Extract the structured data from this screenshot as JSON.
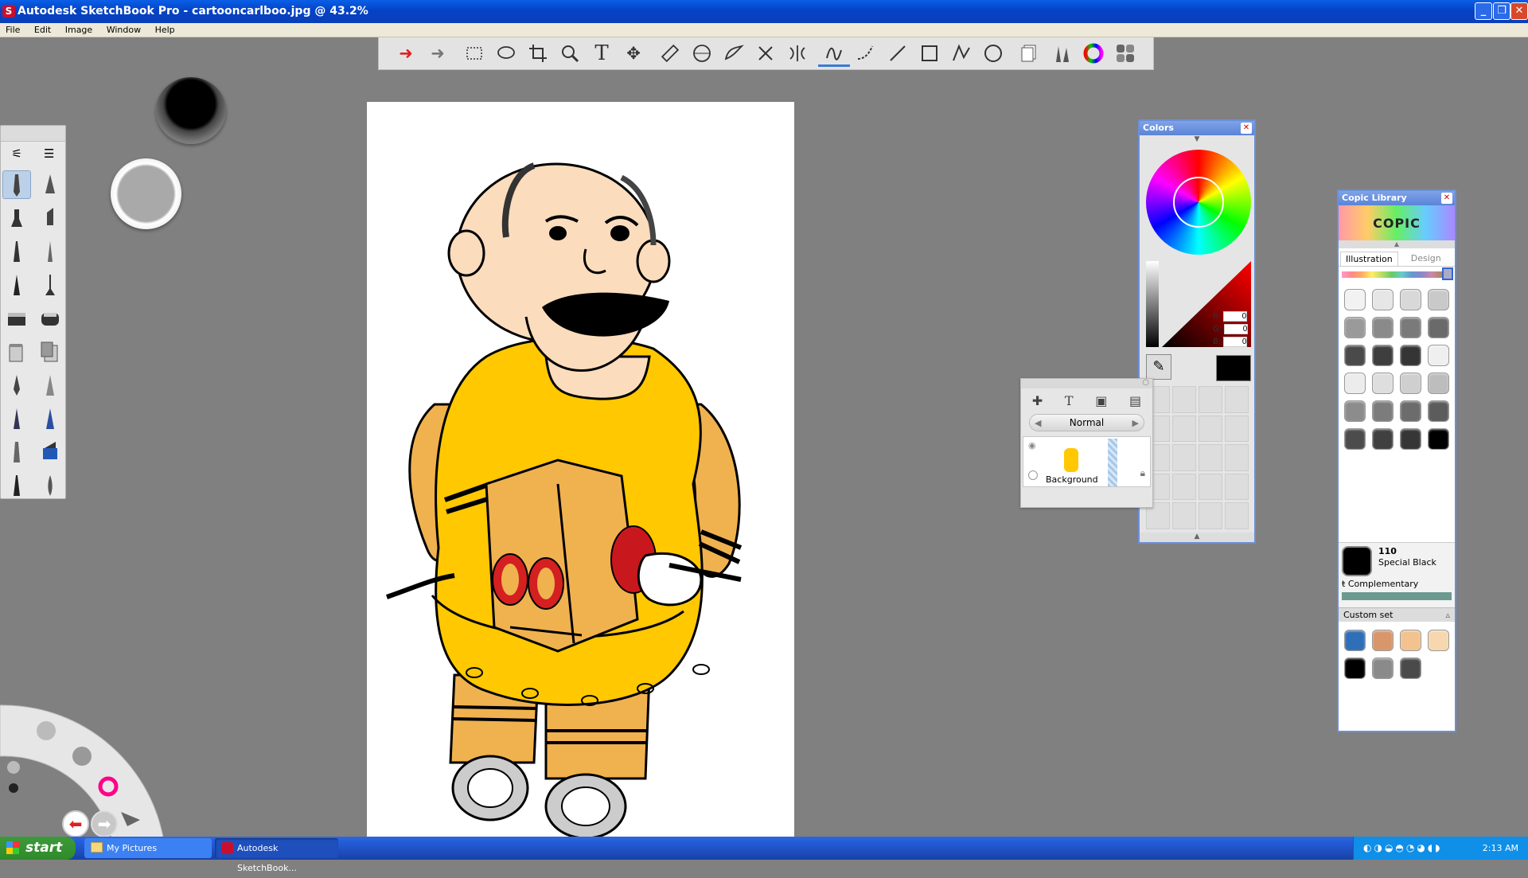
{
  "window": {
    "title": "Autodesk SketchBook Pro - cartooncarlboo.jpg @ 43.2%"
  },
  "menu": [
    "File",
    "Edit",
    "Image",
    "Window",
    "Help"
  ],
  "colors_panel": {
    "title": "Colors",
    "r_label": "R:",
    "g_label": "G:",
    "b_label": "B:",
    "r": "0",
    "g": "0",
    "b": "0",
    "current_color": "#000000"
  },
  "layers_panel": {
    "blend_mode": "Normal",
    "layer_name": "Background"
  },
  "copic": {
    "title": "Copic Library",
    "logo": "COPIC",
    "tabs": [
      "Illustration",
      "Design"
    ],
    "active_color_code": "110",
    "active_color_name": "Special Black",
    "complementary_label": "Complementary",
    "custom_set_label": "Custom set",
    "library_swatches": [
      "#f2f2f2",
      "#e6e6e6",
      "#d8d8d8",
      "#c9c9c9",
      "#9a9a9a",
      "#8a8a8a",
      "#7a7a7a",
      "#6a6a6a",
      "#4a4a4a",
      "#3e3e3e",
      "#353535",
      "#efefef",
      "#ececec",
      "#dedede",
      "#cfcfcf",
      "#bdbdbd",
      "#8c8c8c",
      "#7c7c7c",
      "#6c6c6c",
      "#5c5c5c",
      "#4c4c4c",
      "#404040",
      "#363636",
      "#000000"
    ],
    "custom_swatches": [
      "#2f6fb8",
      "#d9966a",
      "#f2c28f",
      "#f7d7ad",
      "#000000",
      "#8a8a8a",
      "#4a4a4a"
    ]
  },
  "taskbar": {
    "start": "start",
    "tasks": [
      "My Pictures",
      "Autodesk SketchBook..."
    ],
    "clock": "2:13 AM"
  }
}
